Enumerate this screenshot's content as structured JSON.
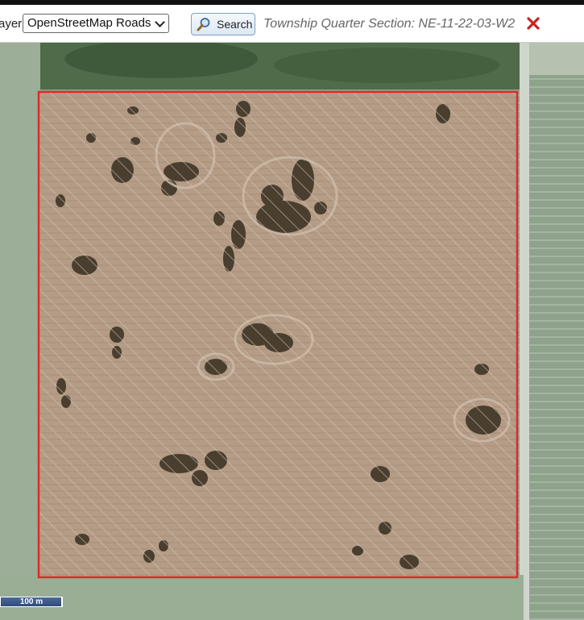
{
  "toolbar": {
    "layer_label": "ayer:",
    "layer_value": "OpenStreetMap Roads",
    "search_label": "Search",
    "result_text": "Township Quarter Section: NE-11-22-03-W2"
  },
  "map": {
    "scale_label": "100 m",
    "highlight_color": "#e02a2a",
    "icons": [
      "search-icon",
      "close-icon",
      "chevron-down-icon"
    ]
  }
}
